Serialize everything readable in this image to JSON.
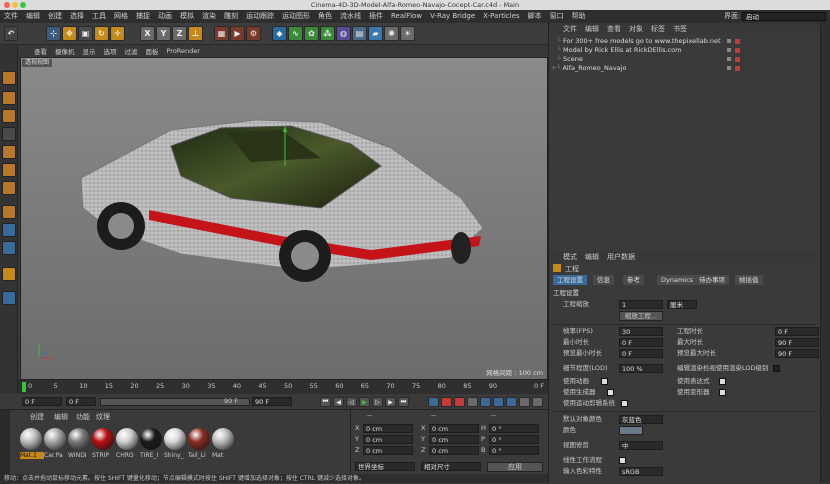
{
  "window": {
    "title": "Cinema-4D-3D-Model-Alfa-Romeo-Navajo-Cocept-Car.c4d - Main"
  },
  "menu": [
    "文件",
    "编辑",
    "创建",
    "选择",
    "工具",
    "网格",
    "捕捉",
    "动画",
    "模拟",
    "渲染",
    "雕刻",
    "运动跟踪",
    "运动图形",
    "角色",
    "流水线",
    "插件",
    "RealFlow",
    "V-Ray Bridge",
    "X-Particles",
    "脚本",
    "窗口",
    "帮助"
  ],
  "layout": {
    "label": "界面:",
    "value": "启动"
  },
  "toolbar": {
    "axis_buttons": [
      "X",
      "Y",
      "Z"
    ]
  },
  "viewport": {
    "menu": [
      "查看",
      "摄像机",
      "显示",
      "选项",
      "过滤",
      "面板",
      "ProRender"
    ],
    "label": "透视视图",
    "grid_text": "网格间距 : 100 cm"
  },
  "timeline": {
    "ticks": [
      "0",
      "5",
      "10",
      "15",
      "20",
      "25",
      "30",
      "35",
      "40",
      "45",
      "50",
      "55",
      "60",
      "65",
      "70",
      "75",
      "80",
      "85",
      "90"
    ],
    "end": "0 F"
  },
  "transport": {
    "start": "0 F",
    "current": "0 F",
    "end_a": "90 F",
    "end_b": "90 F"
  },
  "materials": {
    "menu": [
      "创建",
      "编辑",
      "功能",
      "纹理"
    ],
    "items": [
      "Mat.1",
      "Car.Pa",
      "WINDI",
      "STRIP",
      "CHRO",
      "TIRE_I",
      "Shiny_",
      "Tail_Li",
      "Mat"
    ],
    "colors": [
      "#bfbfbf",
      "#a8a8a8",
      "#7a7a7a",
      "#b80f14",
      "#cfcfcf",
      "#1b1b1b",
      "#d8d8d8",
      "#8a2d22",
      "#bdbdbd"
    ]
  },
  "coords": {
    "headers": [
      "--",
      "--",
      "--"
    ],
    "rows": [
      [
        "X",
        "0 cm",
        "X",
        "0 cm",
        "H",
        "0 °"
      ],
      [
        "Y",
        "0 cm",
        "Y",
        "0 cm",
        "P",
        "0 °"
      ],
      [
        "Z",
        "0 cm",
        "Z",
        "0 cm",
        "B",
        "0 °"
      ]
    ],
    "mode1": "世界坐标",
    "mode2": "相对尺寸",
    "apply": "应用"
  },
  "objects": {
    "menu": [
      "文件",
      "编辑",
      "查看",
      "对象",
      "标签",
      "书签"
    ],
    "items": [
      "For 300+ free models go to www.thepixellab.net",
      "Model by Rick Ellis at RickDEllis.com",
      "Scene",
      "Alfa_Romeo_Navajo"
    ]
  },
  "attributes": {
    "menu": [
      "模式",
      "编辑",
      "用户数据"
    ],
    "title": "工程",
    "tabs": [
      "工程设置",
      "信息",
      "参考",
      "Dynamics",
      "待办事项",
      "帧插值"
    ],
    "section": "工程设置",
    "scale_label": "工程缩放",
    "scale_value": "1",
    "scale_unit": "厘米",
    "scale_button": "缩放工程...",
    "fps_label": "帧率(FPS)",
    "fps_value": "30",
    "duration_label": "工程时长",
    "duration_value": "0 F",
    "min_label": "最小时长",
    "min_value": "0 F",
    "max_label": "最大时长",
    "max_value": "90 F",
    "pmin_label": "预览最小时长",
    "pmin_value": "0 F",
    "pmax_label": "预览最大时长",
    "pmax_value": "90 F",
    "lod_label": "细节程度(LOD)",
    "lod_value": "100 %",
    "lod_check": "编辑渲染检视使用渲染LOD级别",
    "c1": "使用动画",
    "c2": "使用表达式",
    "c3": "使用生成器",
    "c4": "使用变形器",
    "c5": "使用运动剪辑系统",
    "objcolor_label": "默认对象颜色",
    "objcolor_value": "灰蓝色",
    "color_label": "颜色",
    "view_label": "视图修剪",
    "view_value": "中",
    "linear_label": "线性工作流程",
    "input_label": "输入色彩特性",
    "input_value": "sRGB"
  },
  "status": "移动：点击并拖动鼠标移动元素。按住 SHIFT 键量化移动；节点编辑模式时按住 SHIFT 键增加选择对象；按住 CTRL 键减少选择对象。"
}
